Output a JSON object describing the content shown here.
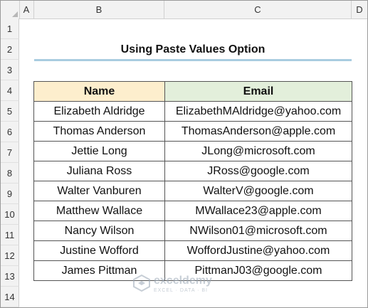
{
  "spreadsheet": {
    "columns": [
      "A",
      "B",
      "C",
      "D"
    ],
    "rows": [
      "1",
      "2",
      "3",
      "4",
      "5",
      "6",
      "7",
      "8",
      "9",
      "10",
      "11",
      "12",
      "13",
      "14"
    ]
  },
  "title": "Using Paste Values Option",
  "table": {
    "headers": {
      "name": "Name",
      "email": "Email"
    },
    "rows": [
      {
        "name": "Elizabeth Aldridge",
        "email": "ElizabethMAldridge@yahoo.com"
      },
      {
        "name": "Thomas Anderson",
        "email": "ThomasAnderson@apple.com"
      },
      {
        "name": "Jettie Long",
        "email": "JLong@microsoft.com"
      },
      {
        "name": "Juliana Ross",
        "email": "JRoss@google.com"
      },
      {
        "name": "Walter Vanburen",
        "email": "WalterV@google.com"
      },
      {
        "name": "Matthew Wallace",
        "email": "MWallace23@apple.com"
      },
      {
        "name": "Nancy Wilson",
        "email": "NWilson01@microsoft.com"
      },
      {
        "name": "Justine Wofford",
        "email": "WoffordJustine@yahoo.com"
      },
      {
        "name": "James Pittman",
        "email": "PittmanJ03@google.com"
      }
    ]
  },
  "watermark": {
    "brand": "exceldemy",
    "tagline": "EXCEL · DATA · BI"
  },
  "colors": {
    "name_header_bg": "#fdeecd",
    "email_header_bg": "#e3efdb",
    "title_underline": "#a9cce0"
  }
}
